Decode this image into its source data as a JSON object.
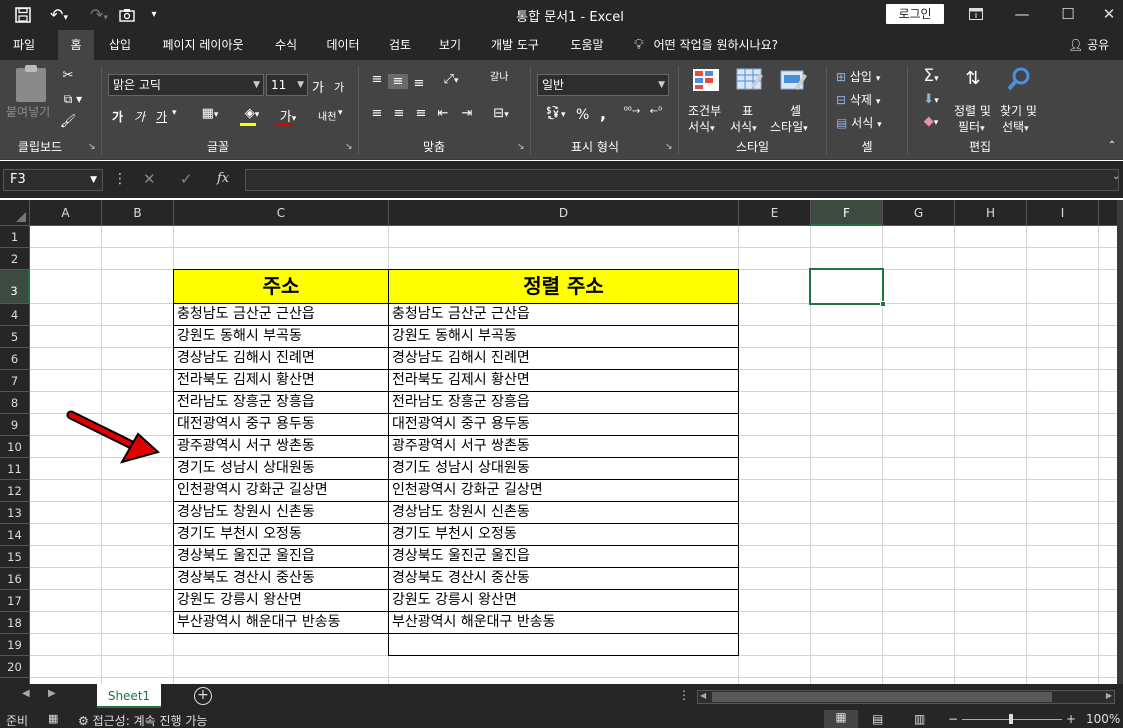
{
  "window": {
    "title": "통합 문서1  -  Excel",
    "login_label": "로그인"
  },
  "tabs": [
    "파일",
    "홈",
    "삽입",
    "페이지 레이아웃",
    "수식",
    "데이터",
    "검토",
    "보기",
    "개발 도구",
    "도움말"
  ],
  "active_tab": "홈",
  "tell_me": "어떤 작업을 원하시나요?",
  "share_label": "공유",
  "ribbon": {
    "clipboard": {
      "label": "클립보드",
      "paste_label": "붙여넣기"
    },
    "font": {
      "label": "글꼴",
      "font_name": "맑은 고딕",
      "font_size": "11",
      "bold": "가",
      "italic": "가",
      "underline": "가",
      "grow": "가",
      "shrink": "가",
      "font_color_glyph": "가",
      "phonetic": "내천"
    },
    "alignment": {
      "label": "맞춤",
      "wrap": "갈나"
    },
    "number": {
      "label": "표시 형식",
      "format": "일반",
      "percent": "%",
      "comma": ","
    },
    "styles": {
      "label": "스타일",
      "conditional_line1": "조건부",
      "conditional_line2": "서식",
      "table_line1": "표",
      "table_line2": "서식",
      "cell_line1": "셀",
      "cell_line2": "스타일"
    },
    "cells": {
      "label": "셀",
      "insert": "삽입",
      "delete": "삭제",
      "format": "서식"
    },
    "editing": {
      "label": "편집",
      "sort_line1": "정렬 및",
      "sort_line2": "필터",
      "find_line1": "찾기 및",
      "find_line2": "선택"
    }
  },
  "formula_bar": {
    "name_box": "F3",
    "fx": "fx",
    "value": ""
  },
  "grid": {
    "columns": [
      "A",
      "B",
      "C",
      "D",
      "E",
      "F",
      "G",
      "H",
      "I"
    ],
    "rows": [
      "1",
      "2",
      "3",
      "4",
      "5",
      "6",
      "7",
      "8",
      "9",
      "10",
      "11",
      "12",
      "13",
      "14",
      "15",
      "16",
      "17",
      "18",
      "19",
      "20"
    ],
    "selected_cell": "F3",
    "header_c": "주소",
    "header_d": "정렬 주소",
    "col_c": [
      "충청남도 금산군 근산읍",
      "강원도 동해시 부곡동",
      "경상남도 김해시 진례면",
      "전라북도 김제시 황산면",
      "전라남도 장흥군 장흥읍",
      "대전광역시 중구 용두동",
      "광주광역시 서구 쌍촌동",
      "경기도 성남시 상대원동",
      "인천광역시 강화군 길상면",
      "경상남도 창원시 신촌동",
      "경기도 부천시 오정동",
      "경상북도 울진군 울진읍",
      "경상북도 경산시 중산동",
      "강원도 강릉시 왕산면",
      "부산광역시 해운대구 반송동"
    ],
    "col_d": [
      "충청남도 금산군 근산읍",
      "강원도 동해시 부곡동",
      "경상남도 김해시 진례면",
      "전라북도 김제시 황산면",
      "전라남도 장흥군 장흥읍",
      "대전광역시 중구 용두동",
      "광주광역시 서구 쌍촌동",
      "경기도 성남시 상대원동",
      "인천광역시 강화군 길상면",
      "경상남도 창원시 신촌동",
      "경기도 부천시 오정동",
      "경상북도 울진군 울진읍",
      "경상북도 경산시 중산동",
      "강원도 강릉시 왕산면",
      "부산광역시 해운대구 반송동",
      ""
    ]
  },
  "sheet_tabs": [
    "Sheet1"
  ],
  "status": {
    "ready": "준비",
    "accessibility": "접근성: 계속 진행 가능",
    "zoom": "100%"
  },
  "colors": {
    "accent": "#217346",
    "header_fill": "#ffff00",
    "arrow": "#e00000"
  }
}
